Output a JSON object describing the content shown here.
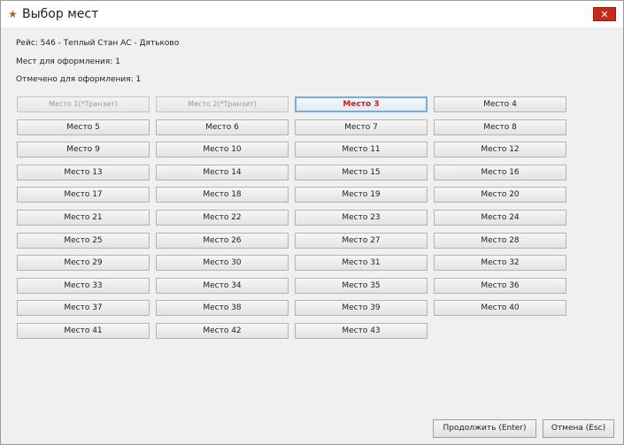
{
  "window": {
    "title": "Выбор мест",
    "close_label": "✕"
  },
  "info": {
    "route": "Рейс: 546 - Теплый Стан АС - Дятьково",
    "seats_to_issue": "Мест для оформления: 1",
    "marked_to_issue": "Отмечено для оформления: 1"
  },
  "seats": [
    {
      "label": "Место 1(*Транзит)",
      "state": "disabled"
    },
    {
      "label": "Место 2(*Транзит)",
      "state": "disabled"
    },
    {
      "label": "Место 3",
      "state": "selected"
    },
    {
      "label": "Место 4",
      "state": "normal"
    },
    {
      "label": "Место 5",
      "state": "normal"
    },
    {
      "label": "Место 6",
      "state": "normal"
    },
    {
      "label": "Место 7",
      "state": "normal"
    },
    {
      "label": "Место 8",
      "state": "normal"
    },
    {
      "label": "Место 9",
      "state": "normal"
    },
    {
      "label": "Место 10",
      "state": "normal"
    },
    {
      "label": "Место 11",
      "state": "normal"
    },
    {
      "label": "Место 12",
      "state": "normal"
    },
    {
      "label": "Место 13",
      "state": "normal"
    },
    {
      "label": "Место 14",
      "state": "normal"
    },
    {
      "label": "Место 15",
      "state": "normal"
    },
    {
      "label": "Место 16",
      "state": "normal"
    },
    {
      "label": "Место 17",
      "state": "normal"
    },
    {
      "label": "Место 18",
      "state": "normal"
    },
    {
      "label": "Место 19",
      "state": "normal"
    },
    {
      "label": "Место 20",
      "state": "normal"
    },
    {
      "label": "Место 21",
      "state": "normal"
    },
    {
      "label": "Место 22",
      "state": "normal"
    },
    {
      "label": "Место 23",
      "state": "normal"
    },
    {
      "label": "Место 24",
      "state": "normal"
    },
    {
      "label": "Место 25",
      "state": "normal"
    },
    {
      "label": "Место 26",
      "state": "normal"
    },
    {
      "label": "Место 27",
      "state": "normal"
    },
    {
      "label": "Место 28",
      "state": "normal"
    },
    {
      "label": "Место 29",
      "state": "normal"
    },
    {
      "label": "Место 30",
      "state": "normal"
    },
    {
      "label": "Место 31",
      "state": "normal"
    },
    {
      "label": "Место 32",
      "state": "normal"
    },
    {
      "label": "Место 33",
      "state": "normal"
    },
    {
      "label": "Место 34",
      "state": "normal"
    },
    {
      "label": "Место 35",
      "state": "normal"
    },
    {
      "label": "Место 36",
      "state": "normal"
    },
    {
      "label": "Место 37",
      "state": "normal"
    },
    {
      "label": "Место 38",
      "state": "normal"
    },
    {
      "label": "Место 39",
      "state": "normal"
    },
    {
      "label": "Место 40",
      "state": "normal"
    },
    {
      "label": "Место 41",
      "state": "normal"
    },
    {
      "label": "Место 42",
      "state": "normal"
    },
    {
      "label": "Место 43",
      "state": "normal"
    }
  ],
  "footer": {
    "continue_label": "Продолжить (Enter)",
    "cancel_label": "Отмена (Esc)"
  },
  "colors": {
    "selected_text": "#e01818",
    "close_button": "#c42b1c"
  }
}
